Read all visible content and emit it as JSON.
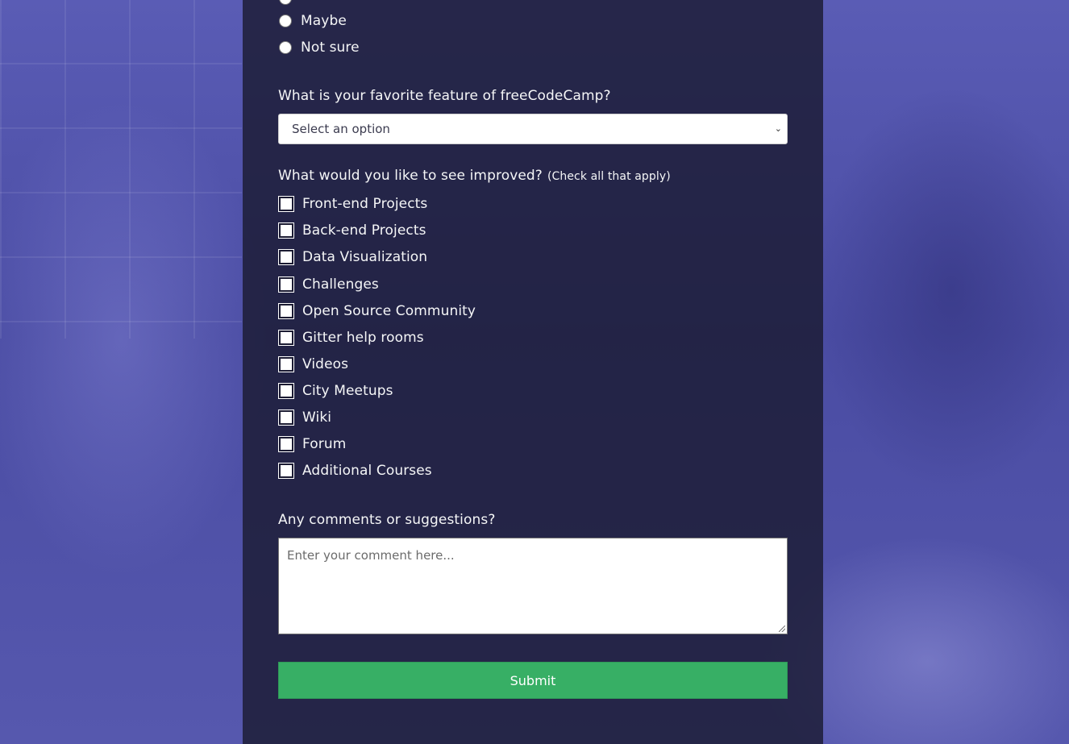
{
  "recommend": {
    "options": [
      "Maybe",
      "Not sure"
    ]
  },
  "favorite_feature": {
    "label": "What is your favorite feature of freeCodeCamp?",
    "selected": "Select an option"
  },
  "improvements": {
    "label": "What would you like to see improved?",
    "hint": "(Check all that apply)",
    "options": [
      "Front-end Projects",
      "Back-end Projects",
      "Data Visualization",
      "Challenges",
      "Open Source Community",
      "Gitter help rooms",
      "Videos",
      "City Meetups",
      "Wiki",
      "Forum",
      "Additional Courses"
    ]
  },
  "comments": {
    "label": "Any comments or suggestions?",
    "placeholder": "Enter your comment here..."
  },
  "submit": {
    "label": "Submit"
  },
  "colors": {
    "overlay": "#1b1b32",
    "submit": "#37af65",
    "text": "#f5f6f7"
  }
}
